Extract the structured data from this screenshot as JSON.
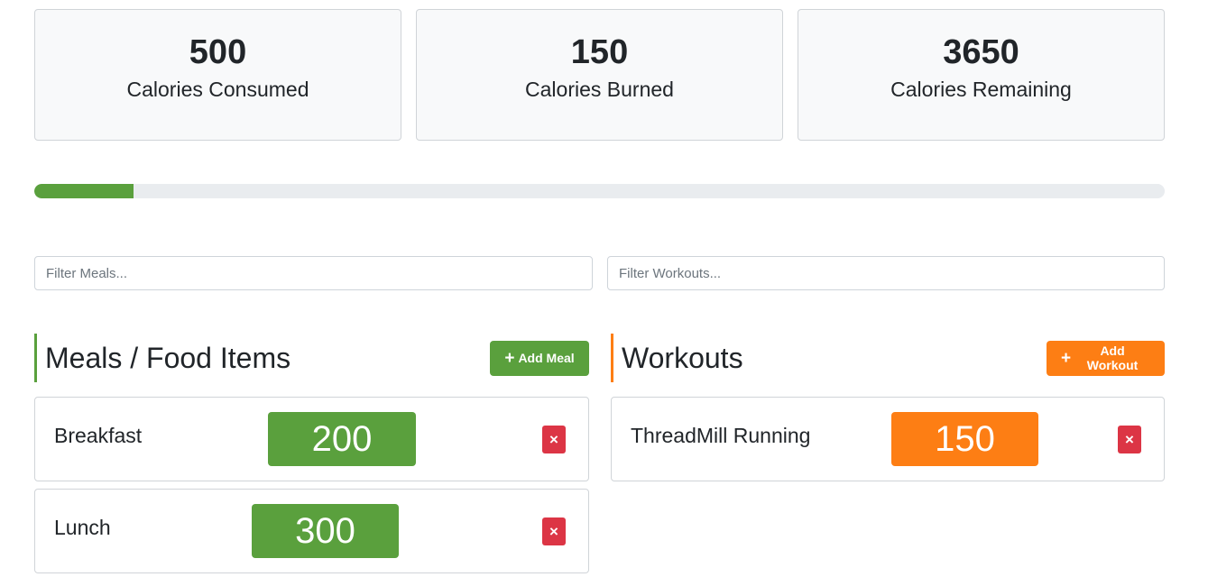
{
  "stats": {
    "consumed": {
      "value": "500",
      "label": "Calories Consumed"
    },
    "burned": {
      "value": "150",
      "label": "Calories Burned"
    },
    "remaining": {
      "value": "3650",
      "label": "Calories Remaining"
    }
  },
  "progress": {
    "fraction": 0.088,
    "color": "#5aa03d"
  },
  "filters": {
    "meals_placeholder": "Filter Meals...",
    "workouts_placeholder": "Filter Workouts..."
  },
  "meals": {
    "title": "Meals / Food Items",
    "add_label": "Add Meal",
    "add_icon": "plus-icon",
    "accent": "#5aa03d",
    "items": [
      {
        "name": "Breakfast",
        "calories": "200",
        "delete_label": "×",
        "delete_icon": "close-icon"
      },
      {
        "name": "Lunch",
        "calories": "300",
        "delete_label": "×",
        "delete_icon": "close-icon"
      }
    ]
  },
  "workouts": {
    "title": "Workouts",
    "add_label": "Add Workout",
    "add_icon": "plus-icon",
    "accent": "#fd7e14",
    "items": [
      {
        "name": "ThreadMill Running",
        "calories": "150",
        "delete_label": "×",
        "delete_icon": "close-icon"
      }
    ]
  },
  "colors": {
    "danger": "#dc3545",
    "success": "#5aa03d",
    "warning": "#fd7e14"
  }
}
